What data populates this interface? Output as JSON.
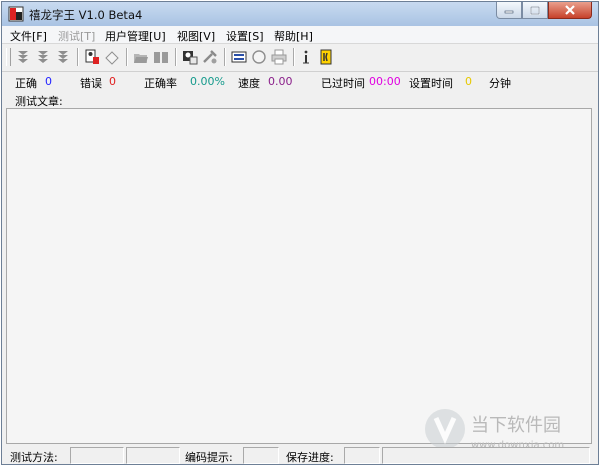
{
  "window": {
    "title": "禧龙字王 V1.0 Beta4"
  },
  "menu": [
    {
      "label": "文件[F]",
      "disabled": false
    },
    {
      "label": "测试[T]",
      "disabled": true
    },
    {
      "label": "用户管理[U]",
      "disabled": false
    },
    {
      "label": "视图[V]",
      "disabled": false
    },
    {
      "label": "设置[S]",
      "disabled": false
    },
    {
      "label": "帮助[H]",
      "disabled": false
    }
  ],
  "stats": {
    "correct_label": "正确",
    "correct_value": "0",
    "error_label": "错误",
    "error_value": "0",
    "accuracy_label": "正确率",
    "accuracy_value": "0.00%",
    "speed_label": "速度",
    "speed_value": "0.00",
    "elapsed_label": "已过时间",
    "elapsed_value": "00:00",
    "settime_label": "设置时间",
    "settime_value": "0",
    "minute_label": "分钟",
    "article_label": "测试文章:"
  },
  "colors": {
    "correct": "#2323ff",
    "error": "#e02020",
    "accuracy": "#159a8c",
    "speed": "#8a1f8a",
    "elapsed": "#e000e0",
    "settime": "#e6c800"
  },
  "bottom": {
    "method_label": "测试方法:",
    "encoding_label": "编码提示:",
    "progress_label": "保存进度:"
  },
  "watermark": {
    "brand": "当下软件园",
    "url": "www.downxia.com"
  }
}
